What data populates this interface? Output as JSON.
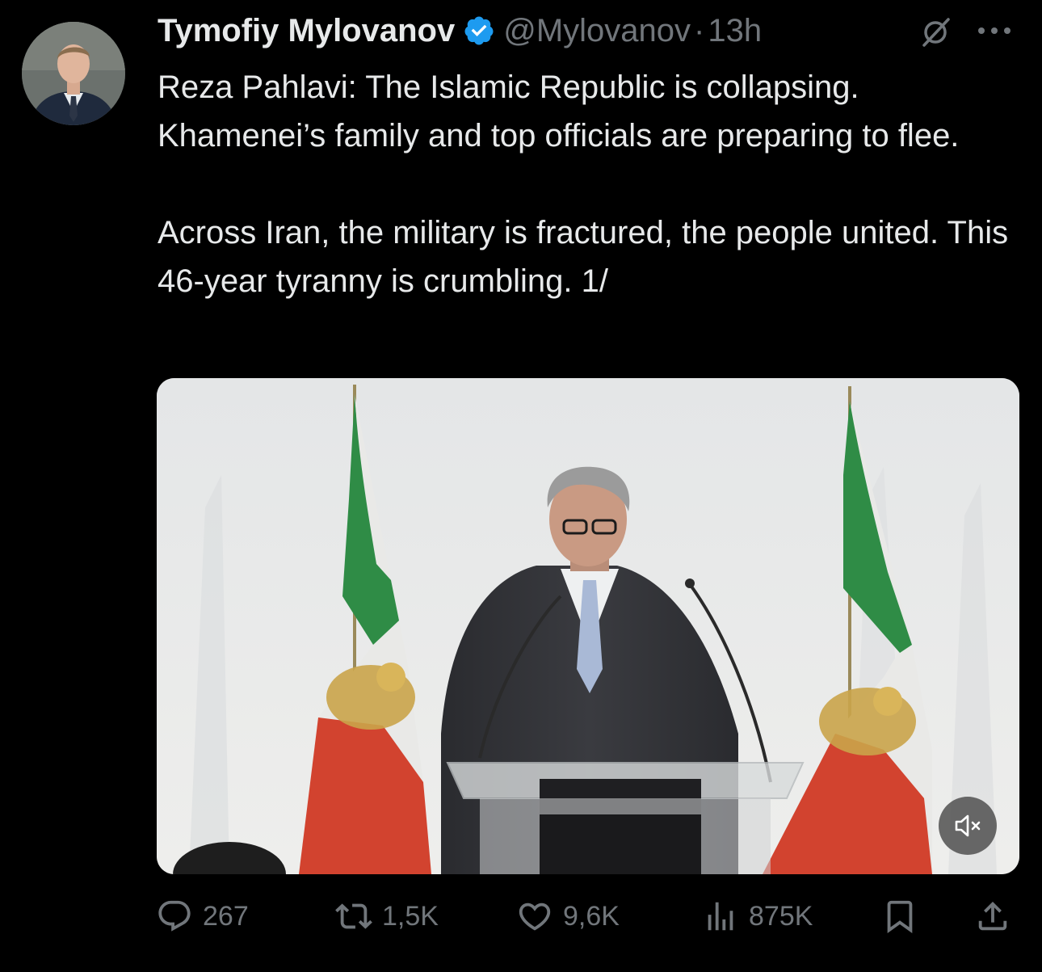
{
  "author": {
    "display_name": "Tymofiy Mylovanov",
    "handle": "@Mylovanov",
    "separator": "·",
    "time": "13h",
    "verified": true,
    "verified_color": "#1d9bf0"
  },
  "tweet": {
    "paragraphs": [
      "Reza Pahlavi: The Islamic Republic is collapsing. Khamenei’s family and top officials are preparing to flee.",
      "Across Iran, the military is fractured, the people united. This 46-year tyranny is crumbling. 1/"
    ]
  },
  "media": {
    "type": "video",
    "muted": true,
    "icon": "speaker-muted-icon"
  },
  "actions": {
    "replies": "267",
    "retweets": "1,5K",
    "likes": "9,6K",
    "views": "875K"
  },
  "icons": {
    "grok": "grok-icon",
    "more": "more-icon",
    "reply": "reply-icon",
    "retweet": "retweet-icon",
    "like": "heart-icon",
    "views": "views-icon",
    "bookmark": "bookmark-icon",
    "share": "share-icon"
  },
  "colors": {
    "background": "#000000",
    "text": "#e7e9ea",
    "secondary": "#71767b",
    "verified": "#1d9bf0"
  }
}
